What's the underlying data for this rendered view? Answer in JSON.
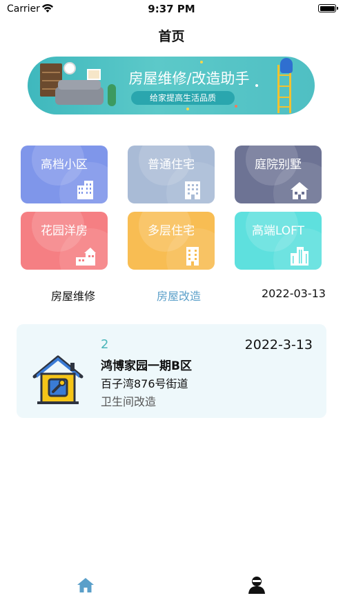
{
  "status_bar": {
    "carrier": "Carrier",
    "time": "9:37 PM"
  },
  "nav": {
    "title": "首页"
  },
  "banner": {
    "title": "房屋维修/改造助手",
    "subtitle": "给家提高生活品质"
  },
  "categories": [
    {
      "label": "高档小区",
      "color": "#7f96ea"
    },
    {
      "label": "普通住宅",
      "color": "#a9bbd6"
    },
    {
      "label": "庭院别墅",
      "color": "#6d7394"
    },
    {
      "label": "花园洋房",
      "color": "#f57f83"
    },
    {
      "label": "多层住宅",
      "color": "#f8bd53"
    },
    {
      "label": "高端LOFT",
      "color": "#5ee0de"
    }
  ],
  "tabs": {
    "repair": "房屋维修",
    "renovation": "房屋改造",
    "date": "2022-03-13"
  },
  "record": {
    "number": "2",
    "date": "2022-3-13",
    "community": "鸿博家园一期B区",
    "address": "百子湾876号街道",
    "type": "卫生间改造"
  },
  "colors": {
    "accent": "#4ab5b9",
    "card_bg": "#eef8fb",
    "tab_active": "#5a9fc9",
    "text": "#111111"
  },
  "tabbar": {
    "home_icon": "house-icon",
    "profile_icon": "user-icon"
  }
}
